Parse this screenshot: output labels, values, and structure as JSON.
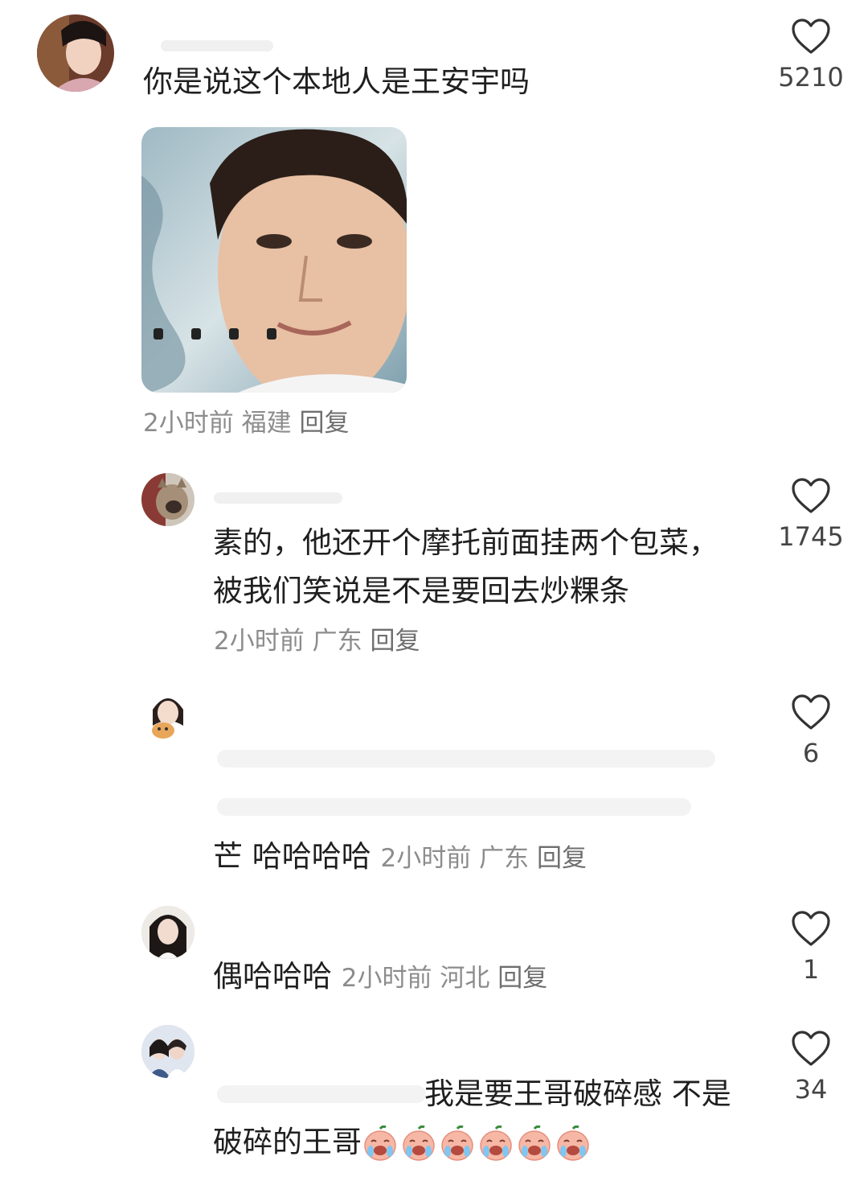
{
  "comments": [
    {
      "text": "你是说这个本地人是王安宇吗",
      "meta_time": "2小时前",
      "meta_location": "福建",
      "reply_label": "回复",
      "likes": "5210",
      "has_image": true
    },
    {
      "text_line1": "素的，他还开个摩托前面挂两个包菜，",
      "text_line2": "被我们笑说是不是要回去炒粿条",
      "meta_time": "2小时前",
      "meta_location": "广东",
      "reply_label": "回复",
      "likes": "1745"
    },
    {
      "partial_char": "芒",
      "text": "哈哈哈哈",
      "meta_time": "2小时前",
      "meta_location": "广东",
      "reply_label": "回复",
      "likes": "6"
    },
    {
      "text": "偶哈哈哈",
      "meta_time": "2小时前",
      "meta_location": "河北",
      "reply_label": "回复",
      "likes": "1"
    },
    {
      "text_line1_visible": "我是要王哥破碎感 不是",
      "text_line2": "破碎的王哥",
      "emoji_count": 6,
      "emoji_name": "crying-peach-emoji",
      "likes": "34"
    }
  ],
  "icons": {
    "like": "heart-outline-icon"
  },
  "colors": {
    "text": "#1f1f1f",
    "meta": "#8c8c8c",
    "icon": "#333333"
  }
}
